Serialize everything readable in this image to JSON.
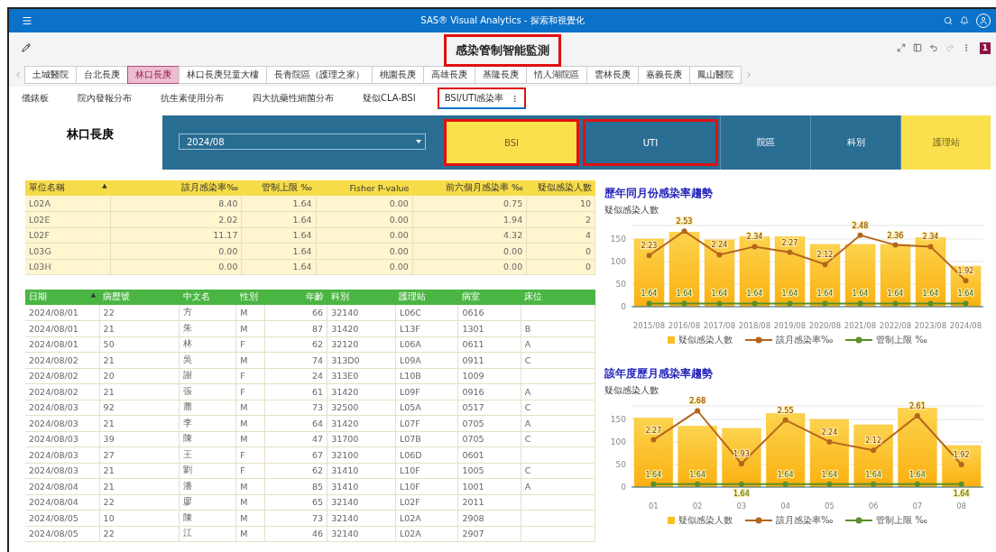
{
  "app_bar": {
    "title": "SAS® Visual Analytics - 探索和視覺化",
    "badge": "1"
  },
  "report": {
    "title": "感染管制智能監測",
    "highlighted": true
  },
  "hospital_tabs": [
    {
      "label": "土城醫院",
      "selected": false
    },
    {
      "label": "台北長庚",
      "selected": false
    },
    {
      "label": "林口長庚",
      "selected": true
    },
    {
      "label": "林口長庚兒童大樓",
      "selected": false
    },
    {
      "label": "長青院區（護理之家）",
      "selected": false
    },
    {
      "label": "桃園長庚",
      "selected": false
    },
    {
      "label": "高雄長庚",
      "selected": false
    },
    {
      "label": "基隆長庚",
      "selected": false
    },
    {
      "label": "情人湖院區",
      "selected": false
    },
    {
      "label": "雲林長庚",
      "selected": false
    },
    {
      "label": "嘉義長庚",
      "selected": false
    },
    {
      "label": "鳳山醫院",
      "selected": false
    }
  ],
  "page_tabs": [
    {
      "label": "儀錶板",
      "selected": false,
      "highlighted": false
    },
    {
      "label": "院內發報分布",
      "selected": false,
      "highlighted": false
    },
    {
      "label": "抗生素使用分布",
      "selected": false,
      "highlighted": false
    },
    {
      "label": "四大抗藥性細菌分布",
      "selected": false,
      "highlighted": false
    },
    {
      "label": "疑似CLA-BSI",
      "selected": false,
      "highlighted": false
    },
    {
      "label": "BSI/UTI感染率",
      "selected": true,
      "highlighted": true
    }
  ],
  "hospital_name": "林口長庚",
  "month_select": {
    "value": "2024/08"
  },
  "infection_buttons": [
    {
      "label": "BSI",
      "selected": true,
      "highlighted": true
    },
    {
      "label": "UTI",
      "selected": false,
      "highlighted": true
    }
  ],
  "level_buttons": [
    {
      "label": "院區",
      "selected": false
    },
    {
      "label": "科別",
      "selected": false
    },
    {
      "label": "護理站",
      "selected": true
    }
  ],
  "unit_table": {
    "columns": [
      {
        "label": "單位名稱",
        "sort": "▲"
      },
      {
        "label": "該月感染率‰"
      },
      {
        "label": "管制上限 ‰"
      },
      {
        "label": "Fisher P-value"
      },
      {
        "label": "前六個月感染率 ‰"
      },
      {
        "label": "疑似感染人數"
      }
    ],
    "rows": [
      [
        "L02A",
        "8.40",
        "1.64",
        "0.00",
        "0.75",
        "10"
      ],
      [
        "L02E",
        "2.02",
        "1.64",
        "0.00",
        "1.94",
        "2"
      ],
      [
        "L02F",
        "11.17",
        "1.64",
        "0.00",
        "4.32",
        "4"
      ],
      [
        "L03G",
        "0.00",
        "1.64",
        "0.00",
        "0.00",
        "0"
      ],
      [
        "L03H",
        "0.00",
        "1.64",
        "0.00",
        "0.00",
        "0"
      ]
    ]
  },
  "case_table": {
    "columns": [
      {
        "label": "日期",
        "sort": "▲"
      },
      {
        "label": "病歷號"
      },
      {
        "label": "中文名"
      },
      {
        "label": "性別"
      },
      {
        "label": "年齡"
      },
      {
        "label": "科別"
      },
      {
        "label": "護理站"
      },
      {
        "label": "病室"
      },
      {
        "label": "床位"
      }
    ],
    "rows": [
      [
        "2024/08/01",
        "22",
        "方",
        "M",
        "66",
        "32140",
        "L06C",
        "0616",
        null
      ],
      [
        "2024/08/01",
        "21",
        "朱",
        "M",
        "87",
        "31420",
        "L13F",
        "1301",
        "B"
      ],
      [
        "2024/08/01",
        "50",
        "林",
        "F",
        "62",
        "32120",
        "L06A",
        "0611",
        "A"
      ],
      [
        "2024/08/02",
        "21",
        "吳",
        "M",
        "74",
        "313D0",
        "L09A",
        "0911",
        "C"
      ],
      [
        "2024/08/02",
        "20",
        "謝",
        "F",
        "24",
        "313E0",
        "L10B",
        "1009",
        null
      ],
      [
        "2024/08/02",
        "21",
        "張",
        "F",
        "61",
        "31420",
        "L09F",
        "0916",
        "A"
      ],
      [
        "2024/08/03",
        "92",
        "蕭",
        "M",
        "73",
        "32500",
        "L05A",
        "0517",
        "C"
      ],
      [
        "2024/08/03",
        "21",
        "李",
        "M",
        "64",
        "31420",
        "L07F",
        "0705",
        "A"
      ],
      [
        "2024/08/03",
        "39",
        "陳",
        "M",
        "47",
        "31700",
        "L07B",
        "0705",
        "C"
      ],
      [
        "2024/08/03",
        "27",
        "王",
        "F",
        "67",
        "32100",
        "L06D",
        "0601",
        null
      ],
      [
        "2024/08/03",
        "21",
        "劉",
        "F",
        "62",
        "31410",
        "L10F",
        "1005",
        "C"
      ],
      [
        "2024/08/04",
        "21",
        "潘",
        "M",
        "85",
        "31410",
        "L10F",
        "1001",
        "A"
      ],
      [
        "2024/08/04",
        "22",
        "廖",
        "M",
        "65",
        "32140",
        "L02F",
        "2011",
        null
      ],
      [
        "2024/08/05",
        "10",
        "陳",
        "M",
        "73",
        "32140",
        "L02A",
        "2908",
        null
      ],
      [
        "2024/08/05",
        "22",
        "江",
        "M",
        "46",
        "32140",
        "L02A",
        "2907",
        null
      ]
    ]
  },
  "charts": [
    {
      "title": "歷年同月份感染率趨勢",
      "chart_data": {
        "type": "bar",
        "ylabel": "疑似感染人數",
        "categories": [
          "2015/08",
          "2016/08",
          "2017/08",
          "2018/08",
          "2019/08",
          "2020/08",
          "2021/08",
          "2022/08",
          "2023/08",
          "2024/08"
        ],
        "series": [
          {
            "name": "疑似感染人數",
            "color": "#fbbf24",
            "values": [
              150,
              165,
              148,
              155,
              155,
              138,
              138,
              138,
              153,
              90
            ]
          },
          {
            "name": "該月感染率‰",
            "color": "#b5651d",
            "type": "line",
            "axis": "y2",
            "marker": "circle",
            "data_labels": true,
            "values": [
              2.23,
              2.53,
              2.24,
              2.34,
              2.27,
              2.12,
              2.48,
              2.36,
              2.34,
              1.92
            ]
          },
          {
            "name": "管制上限 ‰",
            "color": "#5a8f29",
            "type": "line",
            "axis": "y2",
            "marker": "circle",
            "data_labels": true,
            "values": [
              1.64,
              1.64,
              1.64,
              1.64,
              1.64,
              1.64,
              1.64,
              1.64,
              1.64,
              1.64
            ]
          }
        ],
        "ylim": [
          0,
          180
        ],
        "yticks": [
          0,
          50,
          100,
          150
        ],
        "y2lim": [
          1.6,
          2.6
        ],
        "grid": true
      }
    },
    {
      "title": "該年度歷月感染率趨勢",
      "chart_data": {
        "type": "bar",
        "ylabel": "疑似感染人數",
        "categories": [
          "01",
          "02",
          "03",
          "04",
          "05",
          "06",
          "07",
          "08"
        ],
        "series": [
          {
            "name": "疑似感染人數",
            "color": "#fbbf24",
            "values": [
              153,
              135,
              130,
              163,
              150,
              138,
              175,
              92
            ]
          },
          {
            "name": "該月感染率‰",
            "color": "#b5651d",
            "type": "line",
            "axis": "y2",
            "marker": "circle",
            "data_labels": true,
            "values": [
              2.27,
              2.68,
              1.93,
              2.55,
              2.24,
              2.12,
              2.61,
              1.92
            ]
          },
          {
            "name": "管制上限 ‰",
            "color": "#5a8f29",
            "type": "line",
            "axis": "y2",
            "marker": "circle",
            "data_labels": true,
            "values": [
              1.64,
              1.64,
              1.64,
              1.64,
              1.64,
              1.64,
              1.64,
              1.64
            ]
          }
        ],
        "ylim": [
          0,
          180
        ],
        "yticks": [
          0,
          50,
          100,
          150
        ],
        "y2lim": [
          1.6,
          2.75
        ],
        "grid": true
      }
    }
  ]
}
